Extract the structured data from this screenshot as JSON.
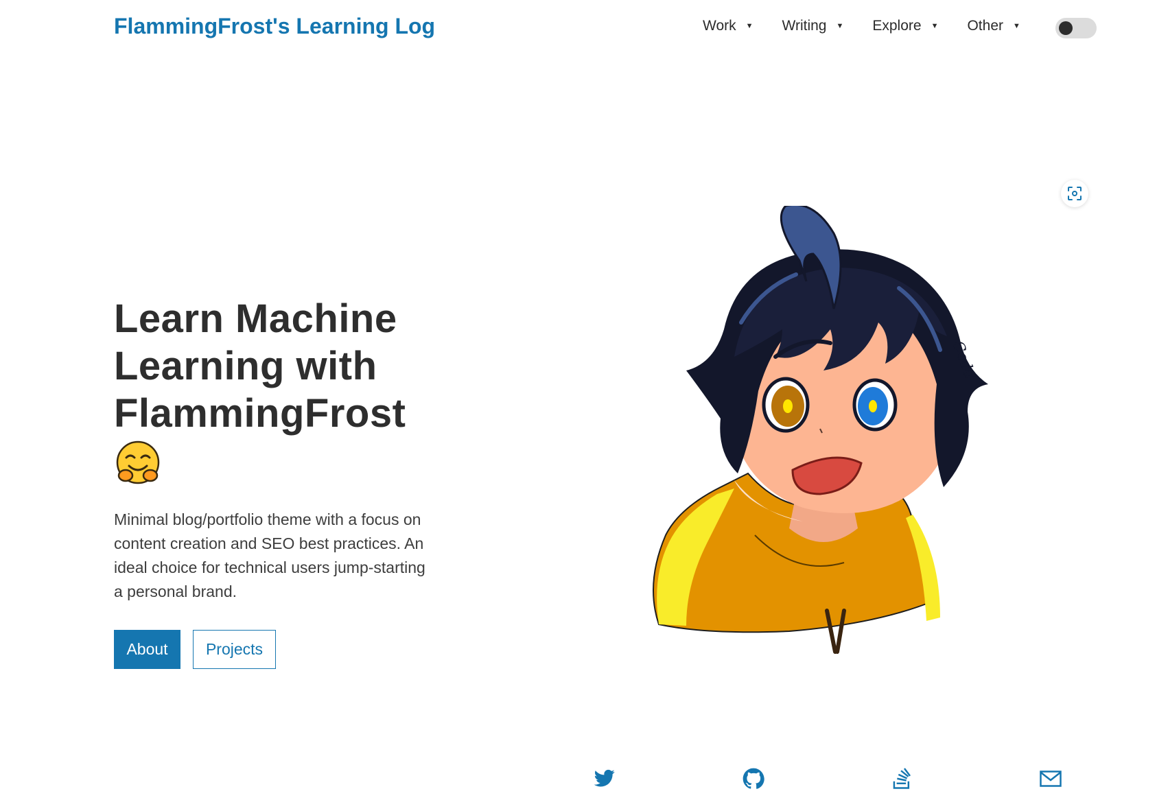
{
  "header": {
    "brand": "FlammingFrost's Learning Log",
    "nav": [
      {
        "label": "Work"
      },
      {
        "label": "Writing"
      },
      {
        "label": "Explore"
      },
      {
        "label": "Other"
      }
    ],
    "theme_toggle": {
      "state": "off"
    }
  },
  "hero": {
    "title": "Learn Machine Learning with FlammingFrost",
    "emoji_icon": "hugging-face-icon",
    "description": "Minimal blog/portfolio theme with a focus on content creation and SEO best practices. An ideal choice for technical users jump-starting a personal brand.",
    "buttons": {
      "about": "About",
      "projects": "Projects"
    }
  },
  "illustration": {
    "signature": "Cedd"
  },
  "social": [
    {
      "icon": "twitter-icon"
    },
    {
      "icon": "github-icon"
    },
    {
      "icon": "stackoverflow-icon"
    },
    {
      "icon": "mail-icon"
    }
  ],
  "colors": {
    "accent": "#1576b0",
    "text": "#2e2e2e",
    "background": "#ffffff"
  }
}
